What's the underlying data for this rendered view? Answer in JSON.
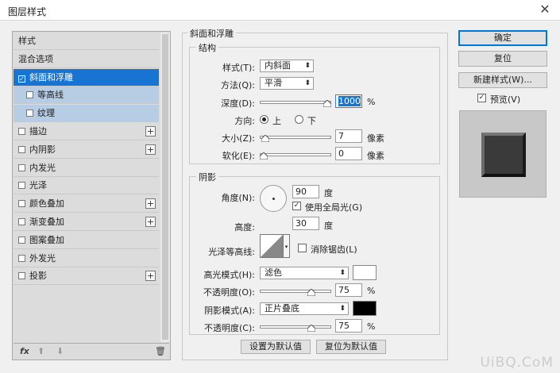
{
  "window": {
    "title": "图层样式",
    "close_glyph": "✕"
  },
  "styles_list": [
    {
      "label": "样式",
      "checkbox": false,
      "plus": false,
      "state": "normal"
    },
    {
      "label": "混合选项",
      "checkbox": false,
      "plus": false,
      "state": "normal"
    },
    {
      "label": "斜面和浮雕",
      "checkbox": true,
      "checked": true,
      "plus": false,
      "state": "selected"
    },
    {
      "label": "等高线",
      "checkbox": true,
      "checked": false,
      "plus": false,
      "state": "sub"
    },
    {
      "label": "纹理",
      "checkbox": true,
      "checked": false,
      "plus": false,
      "state": "sub"
    },
    {
      "label": "描边",
      "checkbox": true,
      "checked": false,
      "plus": true,
      "state": "normal"
    },
    {
      "label": "内阴影",
      "checkbox": true,
      "checked": false,
      "plus": true,
      "state": "normal"
    },
    {
      "label": "内发光",
      "checkbox": true,
      "checked": false,
      "plus": false,
      "state": "normal"
    },
    {
      "label": "光泽",
      "checkbox": true,
      "checked": false,
      "plus": false,
      "state": "normal"
    },
    {
      "label": "颜色叠加",
      "checkbox": true,
      "checked": false,
      "plus": true,
      "state": "normal"
    },
    {
      "label": "渐变叠加",
      "checkbox": true,
      "checked": false,
      "plus": true,
      "state": "normal"
    },
    {
      "label": "图案叠加",
      "checkbox": true,
      "checked": false,
      "plus": false,
      "state": "normal"
    },
    {
      "label": "外发光",
      "checkbox": true,
      "checked": false,
      "plus": false,
      "state": "normal"
    },
    {
      "label": "投影",
      "checkbox": true,
      "checked": false,
      "plus": true,
      "state": "normal"
    }
  ],
  "list_footer": {
    "fx": "fx",
    "up": "⬆",
    "down": "⬇",
    "trash": "🗑"
  },
  "bevel": {
    "group_title": "斜面和浮雕",
    "structure": {
      "title": "结构",
      "style_label": "样式(T):",
      "style_value": "内斜面",
      "method_label": "方法(Q):",
      "method_value": "平滑",
      "depth_label": "深度(D):",
      "depth_value": "1000",
      "depth_unit": "%",
      "depth_level": 1.0,
      "direction_label": "方向:",
      "dir_up": "上",
      "dir_down": "下",
      "size_label": "大小(Z):",
      "size_value": "7",
      "size_unit": "像素",
      "size_level": 0.03,
      "soften_label": "软化(E):",
      "soften_value": "0",
      "soften_unit": "像素",
      "soften_level": 0.0
    },
    "shading": {
      "title": "阴影",
      "angle_label": "角度(N):",
      "angle_value": "90",
      "angle_unit": "度",
      "global_light_label": "使用全局光(G)",
      "altitude_label": "高度:",
      "altitude_value": "30",
      "altitude_unit": "度",
      "gloss_label": "光泽等高线:",
      "antialias_label": "消除锯齿(L)",
      "highlight_label": "高光模式(H):",
      "highlight_mode": "滤色",
      "highlight_color": "#ffffff",
      "highlight_opacity_label": "不透明度(O):",
      "highlight_opacity": "75",
      "highlight_opacity_level": 0.75,
      "shadow_label": "阴影模式(A):",
      "shadow_mode": "正片叠底",
      "shadow_color": "#000000",
      "shadow_opacity_label": "不透明度(C):",
      "shadow_opacity": "75",
      "shadow_opacity_level": 0.75,
      "pct": "%"
    },
    "make_default": "设置为默认值",
    "reset_default": "复位为默认值"
  },
  "buttons": {
    "ok": "确定",
    "reset": "复位",
    "new_style": "新建样式(W)...",
    "preview": "预览(V)"
  },
  "watermark": "UiBQ.CoM"
}
